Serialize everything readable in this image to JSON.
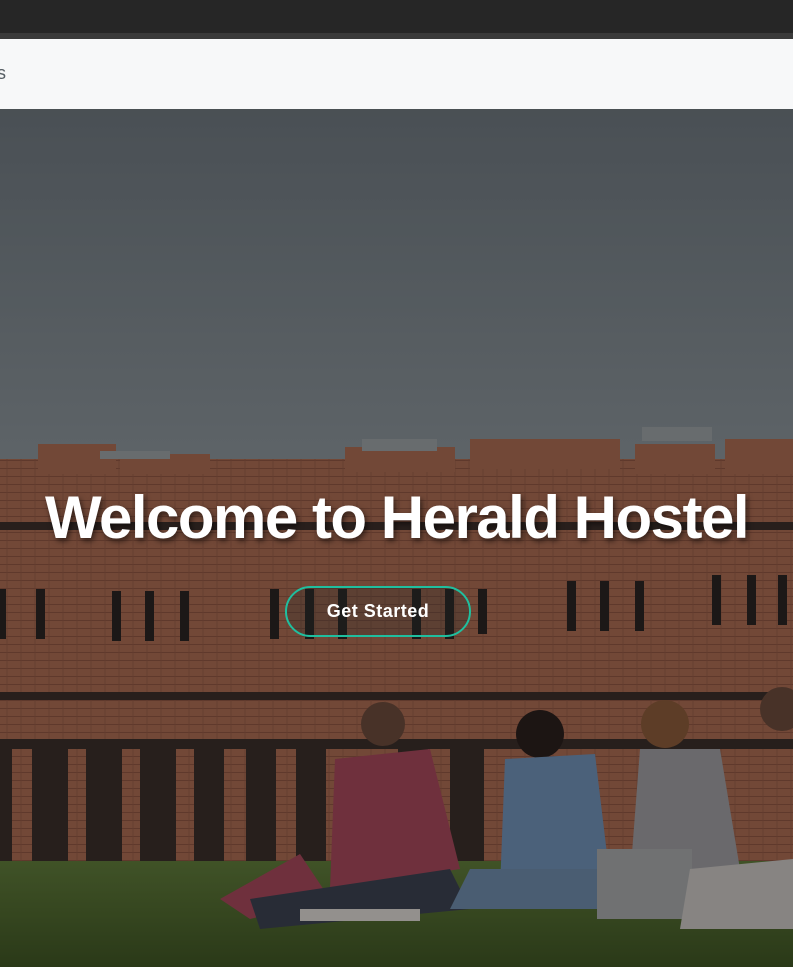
{
  "navbar": {
    "partial_label": "s"
  },
  "hero": {
    "title": "Welcome to Herald Hostel",
    "cta_label": "Get Started",
    "accent_color": "#1fbf9f"
  }
}
